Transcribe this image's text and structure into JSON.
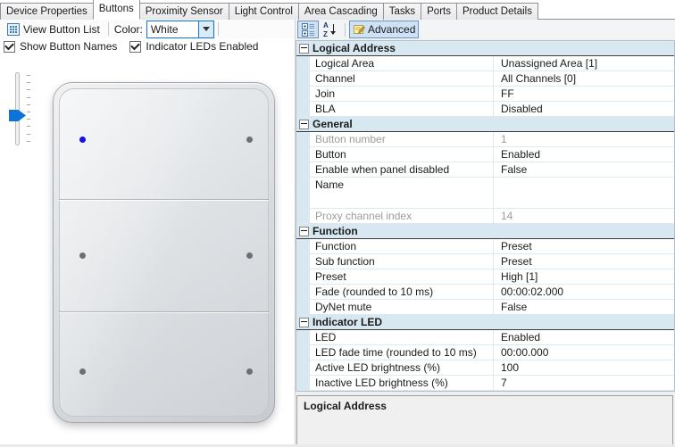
{
  "tabs": {
    "items": [
      {
        "label": "Device Properties",
        "active": false
      },
      {
        "label": "Buttons",
        "active": true
      },
      {
        "label": "Proximity Sensor",
        "active": false
      },
      {
        "label": "Light Control",
        "active": false
      },
      {
        "label": "Area Cascading",
        "active": false
      },
      {
        "label": "Tasks",
        "active": false
      },
      {
        "label": "Ports",
        "active": false
      },
      {
        "label": "Product Details",
        "active": false
      }
    ]
  },
  "left_toolbar": {
    "view_button_list_label": "View Button List",
    "color_label": "Color:",
    "color_value": "White",
    "checkboxes": [
      {
        "label": "Show Button Names",
        "checked": true
      },
      {
        "label": "Indicator LEDs Enabled",
        "checked": true
      }
    ]
  },
  "right_toolbar": {
    "categorized_icon": "categorized-icon",
    "sort_icon": "sort-az-icon",
    "advanced_label": "Advanced"
  },
  "keypad": {
    "leds": [
      "on",
      "off",
      "off",
      "off",
      "off",
      "off"
    ]
  },
  "property_grid": {
    "categories": [
      {
        "name": "Logical Address",
        "rows": [
          {
            "label": "Logical Area",
            "value": "Unassigned Area [1]"
          },
          {
            "label": "Channel",
            "value": "All Channels [0]"
          },
          {
            "label": "Join",
            "value": "FF"
          },
          {
            "label": "BLA",
            "value": "Disabled"
          }
        ]
      },
      {
        "name": "General",
        "rows": [
          {
            "label": "Button number",
            "value": "1",
            "readonly": true
          },
          {
            "label": "Button",
            "value": "Enabled"
          },
          {
            "label": "Enable when panel disabled",
            "value": "False"
          },
          {
            "label": "Name",
            "value": "",
            "tall": true
          },
          {
            "label": "Proxy channel index",
            "value": "14",
            "readonly": true
          }
        ]
      },
      {
        "name": "Function",
        "rows": [
          {
            "label": "Function",
            "value": "Preset"
          },
          {
            "label": "Sub function",
            "value": "Preset"
          },
          {
            "label": "Preset",
            "value": "High [1]"
          },
          {
            "label": "Fade (rounded to 10 ms)",
            "value": "00:00:02.000"
          },
          {
            "label": "DyNet mute",
            "value": "False"
          }
        ]
      },
      {
        "name": "Indicator LED",
        "rows": [
          {
            "label": "LED",
            "value": "Enabled"
          },
          {
            "label": "LED fade time (rounded to 10 ms)",
            "value": "00:00.000"
          },
          {
            "label": "Active LED brightness (%)",
            "value": "100"
          },
          {
            "label": "Inactive LED brightness (%)",
            "value": "7"
          }
        ]
      }
    ]
  },
  "description": {
    "title": "Logical Address"
  },
  "colors": {
    "accent": "#0c74d8",
    "category_bg": "#d7e8f1",
    "grid_line": "#dbe9f2",
    "readonly_text": "#9c9c9c",
    "led_on": "#1212e8",
    "led_off": "#6d7073",
    "toggle_bg": "#cee2f6",
    "toggle_border": "#7191bd"
  }
}
